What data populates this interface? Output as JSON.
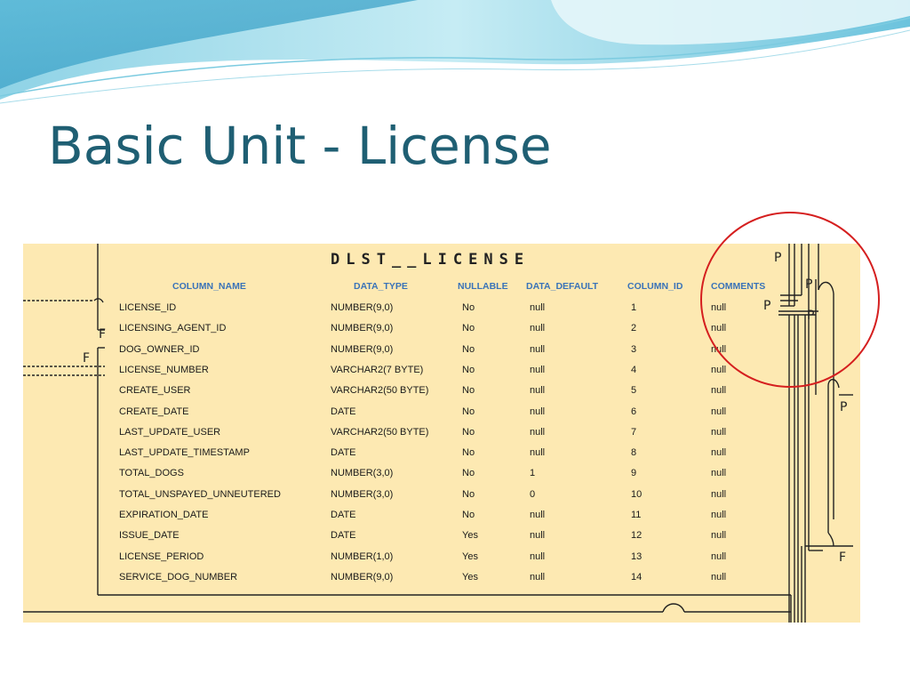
{
  "slide": {
    "title": "Basic Unit - License"
  },
  "diagram": {
    "table_name": "DLST__LICENSE",
    "columns": [
      "COLUMN_NAME",
      "DATA_TYPE",
      "NULLABLE",
      "DATA_DEFAULT",
      "COLUMN_ID",
      "COMMENTS"
    ],
    "rows": [
      [
        "LICENSE_ID",
        "NUMBER(9,0)",
        "No",
        "null",
        "1",
        "null"
      ],
      [
        "LICENSING_AGENT_ID",
        "NUMBER(9,0)",
        "No",
        "null",
        "2",
        "null"
      ],
      [
        "DOG_OWNER_ID",
        "NUMBER(9,0)",
        "No",
        "null",
        "3",
        "null"
      ],
      [
        "LICENSE_NUMBER",
        "VARCHAR2(7 BYTE)",
        "No",
        "null",
        "4",
        "null"
      ],
      [
        "CREATE_USER",
        "VARCHAR2(50 BYTE)",
        "No",
        "null",
        "5",
        "null"
      ],
      [
        "CREATE_DATE",
        "DATE",
        "No",
        "null",
        "6",
        "null"
      ],
      [
        "LAST_UPDATE_USER",
        "VARCHAR2(50 BYTE)",
        "No",
        "null",
        "7",
        "null"
      ],
      [
        "LAST_UPDATE_TIMESTAMP",
        "DATE",
        "No",
        "null",
        "8",
        "null"
      ],
      [
        "TOTAL_DOGS",
        "NUMBER(3,0)",
        "No",
        "1",
        "9",
        "null"
      ],
      [
        "TOTAL_UNSPAYED_UNNEUTERED",
        "NUMBER(3,0)",
        "No",
        "0",
        "10",
        "null"
      ],
      [
        "EXPIRATION_DATE",
        "DATE",
        "No",
        "null",
        "11",
        "null"
      ],
      [
        "ISSUE_DATE",
        "DATE",
        "Yes",
        "null",
        "12",
        "null"
      ],
      [
        "LICENSE_PERIOD",
        "NUMBER(1,0)",
        "Yes",
        "null",
        "13",
        "null"
      ],
      [
        "SERVICE_DOG_NUMBER",
        "NUMBER(9,0)",
        "Yes",
        "null",
        "14",
        "null"
      ]
    ],
    "relation_markers": {
      "f_left_1": "F",
      "f_left_2": "F",
      "p_top": "P",
      "p_mid_1": "P",
      "p_mid_2": "P",
      "p_mid_3": "P",
      "p_right": "P",
      "f_right": "F"
    },
    "colors": {
      "background": "#fde9b2",
      "header_text": "#3a73b8",
      "highlight_circle": "#d51f1f",
      "title": "#1f5f73"
    }
  }
}
